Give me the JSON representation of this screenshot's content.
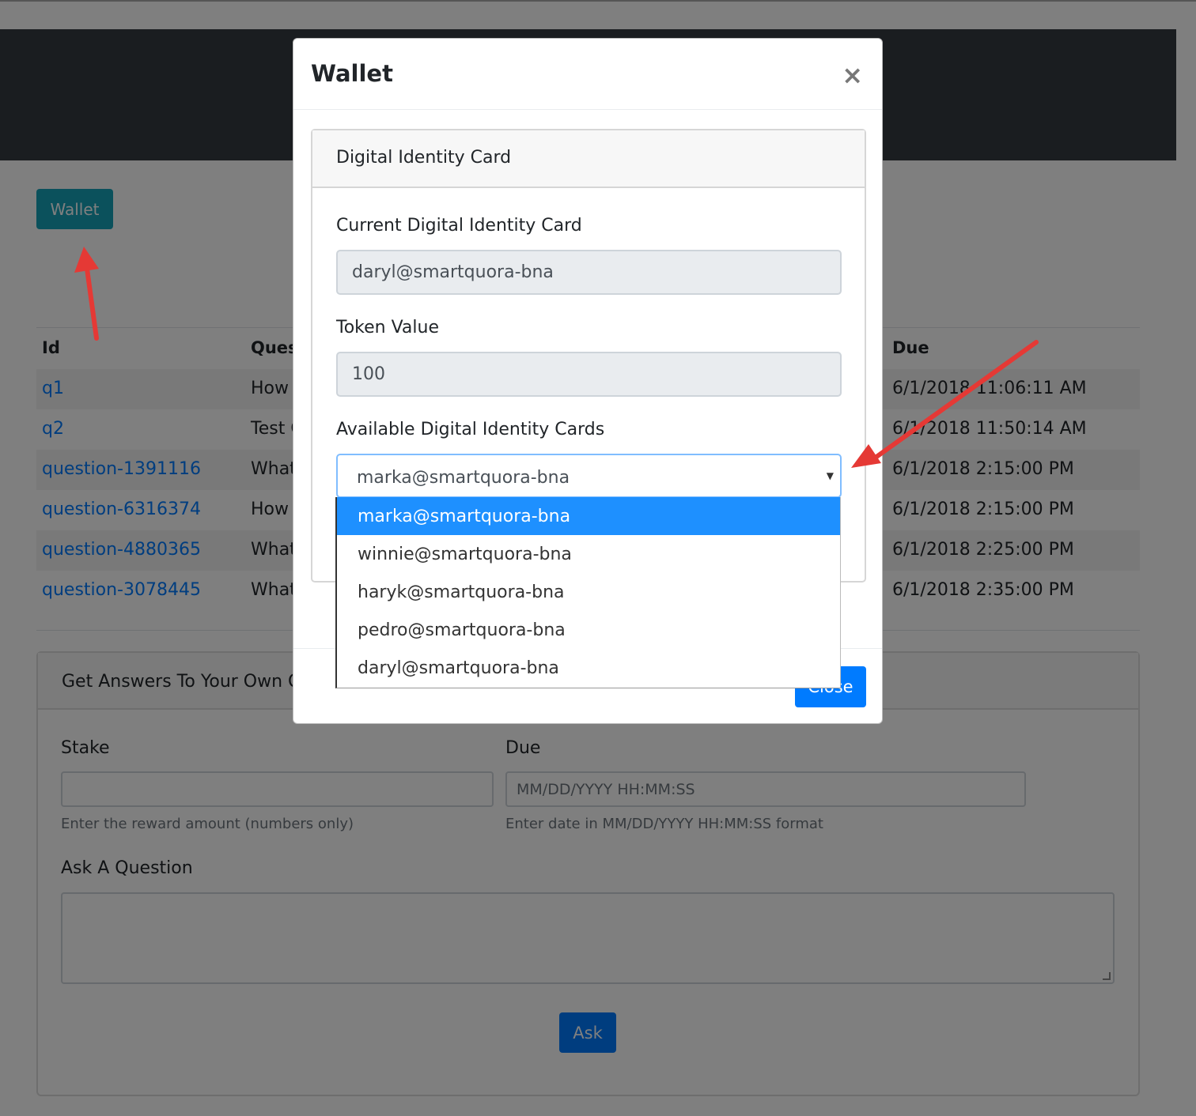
{
  "page": {
    "wallet_button": "Wallet",
    "table": {
      "headers": {
        "id": "Id",
        "question": "Ques",
        "due": "Due"
      },
      "rows": [
        {
          "id": "q1",
          "question": "How",
          "due": "6/1/2018 11:06:11 AM"
        },
        {
          "id": "q2",
          "question": "Test Q",
          "due": "6/1/2018 11:50:14 AM"
        },
        {
          "id": "question-1391116",
          "question": "What",
          "due": "6/1/2018 2:15:00 PM"
        },
        {
          "id": "question-6316374",
          "question": "How",
          "due": "6/1/2018 2:15:00 PM"
        },
        {
          "id": "question-4880365",
          "question": "What",
          "due": "6/1/2018 2:25:00 PM"
        },
        {
          "id": "question-3078445",
          "question": "What",
          "due": "6/1/2018 2:35:00 PM"
        }
      ]
    },
    "ask_card": {
      "title": "Get Answers To Your Own Q",
      "stake_label": "Stake",
      "stake_value": "",
      "stake_help": "Enter the reward amount (numbers only)",
      "due_label": "Due",
      "due_placeholder": "MM/DD/YYYY HH:MM:SS",
      "due_help": "Enter date in MM/DD/YYYY HH:MM:SS format",
      "question_label": "Ask A Question",
      "ask_button": "Ask"
    }
  },
  "modal": {
    "title": "Wallet",
    "close_icon": "×",
    "card_title": "Digital Identity Card",
    "current_label": "Current Digital Identity Card",
    "current_value": "daryl@smartquora-bna",
    "token_label": "Token Value",
    "token_value": "100",
    "available_label": "Available Digital Identity Cards",
    "selected": "marka@smartquora-bna",
    "caret": "▼",
    "options": [
      "marka@smartquora-bna",
      "winnie@smartquora-bna",
      "haryk@smartquora-bna",
      "pedro@smartquora-bna",
      "daryl@smartquora-bna"
    ],
    "close_button": "Close"
  },
  "colors": {
    "hero": "#343a40",
    "info": "#17a2b8",
    "primary": "#007bff",
    "dropdown_highlight": "#1e90ff",
    "arrow": "#e53935"
  },
  "icons": {
    "close": "close-icon",
    "caret": "chevron-down-icon"
  }
}
